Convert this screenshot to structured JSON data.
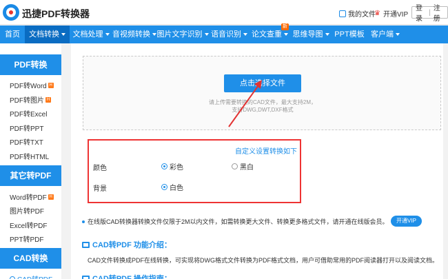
{
  "header": {
    "brand": "迅捷PDF转换器",
    "my_files": "我的文件",
    "vip": "开通VIP",
    "login": "登录",
    "register": "注册"
  },
  "nav": {
    "items": [
      {
        "label": "首页"
      },
      {
        "label": "文档转换"
      },
      {
        "label": "文档处理"
      },
      {
        "label": "音视频转换"
      },
      {
        "label": "图片文字识别"
      },
      {
        "label": "语音识别"
      },
      {
        "label": "论文查重",
        "badge": "新"
      },
      {
        "label": "思维导图"
      },
      {
        "label": "PPT模板"
      },
      {
        "label": "客户端"
      }
    ]
  },
  "sidebar": {
    "pdf_head": "PDF转换",
    "pdf_items": [
      "PDF转Word",
      "PDF转图片",
      "PDF转Excel",
      "PDF转PPT",
      "PDF转TXT",
      "PDF转HTML"
    ],
    "other_head": "其它转PDF",
    "other_items": [
      "Word转PDF",
      "图片转PDF",
      "Excel转PDF",
      "PPT转PDF"
    ],
    "cad_head": "CAD转换",
    "cad_items": [
      "CAD转PDF"
    ]
  },
  "upload": {
    "button": "点击选择文件",
    "tip_line1": "请上传需要转换的CAD文件，最大支持2M，",
    "tip_line2": "支持DWG,DWT,DXF格式"
  },
  "settings": {
    "title": "自定义设置转换如下",
    "color_label": "颜色",
    "color_opt1": "彩色",
    "color_opt2": "黑白",
    "bg_label": "背景",
    "bg_opt1": "白色"
  },
  "notice": {
    "text": "在线版CAD转换器转换文件仅限于2M以内文件，如需转换更大文件、转换更多格式文件，请开通在线版会员。",
    "vip_button": "开通VIP"
  },
  "sections": {
    "intro_title": "CAD转PDF 功能介绍：",
    "intro_text": "CAD文件转换成PDF在线转换，可实现将DWG格式文件转换为PDF格式文档，用户可借助常用的PDF阅读器打开以及阅读文档。",
    "guide_title": "CAD转PDF 操作指南："
  },
  "colors": {
    "accent": "#1f8fe8",
    "nav_active": "#0a6cc2",
    "highlight_red": "#e33333"
  }
}
